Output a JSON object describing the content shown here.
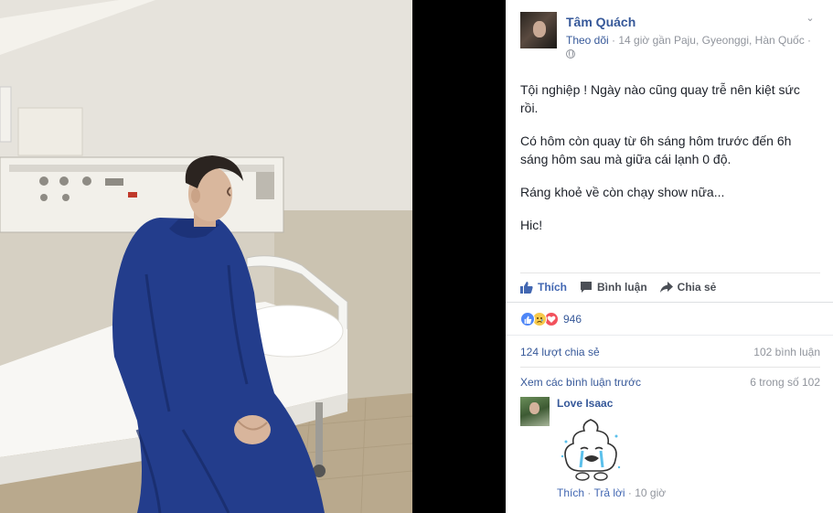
{
  "post": {
    "author": "Tâm Quách",
    "follow_label": "Theo dõi",
    "meta": "· 14 giờ gần Paju, Gyeonggi, Hàn Quốc ·",
    "paragraphs": [
      "Tội nghiệp ! Ngày nào cũng quay trễ nên kiệt sức rồi.",
      "Có hôm còn quay từ 6h sáng hôm trước đến 6h sáng hôm sau mà giữa cái lạnh 0 độ.",
      "Ráng khoẻ về còn chạy show nữa...",
      "Hic!"
    ]
  },
  "actions": {
    "like": "Thích",
    "comment": "Bình luận",
    "share": "Chia sẻ"
  },
  "reactions": {
    "count": "946",
    "icons": [
      "like-icon",
      "sad-icon",
      "love-icon"
    ]
  },
  "stats": {
    "shares": "124 lượt chia sẻ",
    "comments": "102 bình luận"
  },
  "comments_section": {
    "view_previous": "Xem các bình luận trước",
    "pager": "6 trong số 102",
    "comment": {
      "author": "Love Isaac",
      "like": "Thích",
      "separator": " · ",
      "reply": "Trả lời",
      "time": " · 10 giờ"
    }
  },
  "colors": {
    "link": "#365899",
    "like_blue": "#4267b2",
    "muted": "#90949c",
    "text": "#1d2129"
  }
}
